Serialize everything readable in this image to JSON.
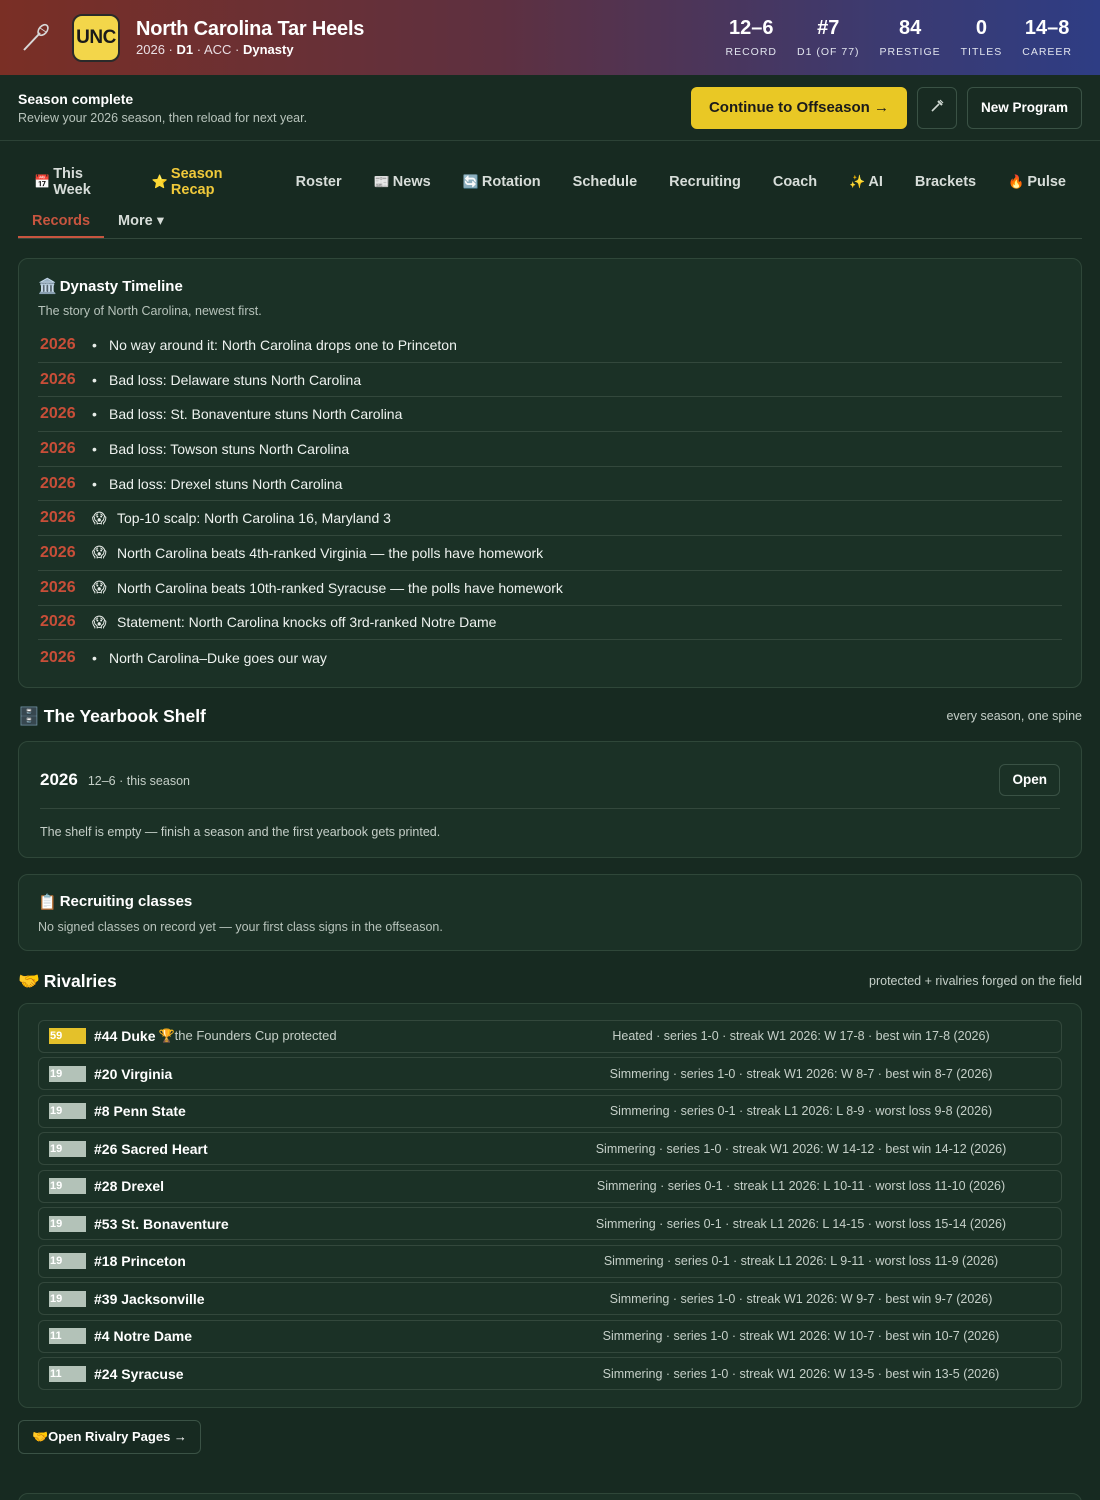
{
  "header": {
    "logo_text": "UNC",
    "program_name": "North Carolina Tar Heels",
    "sub_year": "2026",
    "sub_div": "D1",
    "sub_conf": "ACC",
    "sub_mode": "Dynasty",
    "stats": [
      {
        "value": "12–6",
        "label": "RECORD"
      },
      {
        "value": "#7",
        "label": "D1 (OF 77)"
      },
      {
        "value": "84",
        "label": "PRESTIGE"
      },
      {
        "value": "0",
        "label": "TITLES"
      },
      {
        "value": "14–8",
        "label": "CAREER"
      }
    ]
  },
  "season_bar": {
    "title": "Season complete",
    "subtitle": "Review your 2026 season, then reload for next year.",
    "continue_label": "Continue to Offseason →",
    "new_program_label": "New Program"
  },
  "tabs": [
    {
      "icon": "📅",
      "label": "This Week"
    },
    {
      "icon": "⭐",
      "label": "Season Recap"
    },
    {
      "icon": "",
      "label": "Roster"
    },
    {
      "icon": "📰",
      "label": "News"
    },
    {
      "icon": "🔄",
      "label": "Rotation"
    },
    {
      "icon": "",
      "label": "Schedule"
    },
    {
      "icon": "",
      "label": "Recruiting"
    },
    {
      "icon": "",
      "label": "Coach"
    },
    {
      "icon": "✨",
      "label": "AI"
    },
    {
      "icon": "",
      "label": "Brackets"
    },
    {
      "icon": "🔥",
      "label": "Pulse"
    }
  ],
  "subtabs": [
    {
      "label": "Records"
    },
    {
      "label": "More ▾"
    }
  ],
  "timeline": {
    "icon": "🏛️",
    "title": "Dynasty Timeline",
    "subtitle": "The story of North Carolina, newest first.",
    "entries": [
      {
        "year": "2026",
        "marker": "•",
        "text": "No way around it: North Carolina drops one to Princeton"
      },
      {
        "year": "2026",
        "marker": "•",
        "text": "Bad loss: Delaware stuns North Carolina"
      },
      {
        "year": "2026",
        "marker": "•",
        "text": "Bad loss: St. Bonaventure stuns North Carolina"
      },
      {
        "year": "2026",
        "marker": "•",
        "text": "Bad loss: Towson stuns North Carolina"
      },
      {
        "year": "2026",
        "marker": "•",
        "text": "Bad loss: Drexel stuns North Carolina"
      },
      {
        "year": "2026",
        "marker": "😱",
        "text": "Top-10 scalp: North Carolina 16, Maryland 3"
      },
      {
        "year": "2026",
        "marker": "😱",
        "text": "North Carolina beats 4th-ranked Virginia — the polls have homework"
      },
      {
        "year": "2026",
        "marker": "😱",
        "text": "North Carolina beats 10th-ranked Syracuse — the polls have homework"
      },
      {
        "year": "2026",
        "marker": "😱",
        "text": "Statement: North Carolina knocks off 3rd-ranked Notre Dame"
      },
      {
        "year": "2026",
        "marker": "•",
        "text": "North Carolina–Duke goes our way"
      }
    ]
  },
  "yearbook": {
    "icon": "🗄️",
    "title": "The Yearbook Shelf",
    "right_note": "every season, one spine",
    "year": "2026",
    "year_sub": "12–6 · this season",
    "open_label": "Open",
    "empty_text": "The shelf is empty — finish a season and the first yearbook gets printed."
  },
  "recruiting_classes": {
    "icon": "📋",
    "title": "Recruiting classes",
    "text": "No signed classes on record yet — your first class signs in the offseason."
  },
  "rivalries": {
    "icon": "🤝",
    "title": "Rivalries",
    "right_note": "protected + rivalries forged on the field",
    "open_pages_label": "🤝Open Rivalry Pages →",
    "items": [
      {
        "heat": "59",
        "heat_fraction": 0.59,
        "name": "#44 Duke",
        "note": "🏆the Founders Cup protected",
        "detail": "Heated · series 1-0 · streak W1  2026: W 17-8 · best win 17-8 (2026)"
      },
      {
        "heat": "19",
        "heat_fraction": 0,
        "name": "#20 Virginia",
        "note": "",
        "detail": "Simmering · series 1-0 · streak W1  2026: W 8-7 · best win 8-7 (2026)"
      },
      {
        "heat": "19",
        "heat_fraction": 0,
        "name": "#8 Penn State",
        "note": "",
        "detail": "Simmering · series 0-1 · streak L1  2026: L 8-9 · worst loss 9-8 (2026)"
      },
      {
        "heat": "19",
        "heat_fraction": 0,
        "name": "#26 Sacred Heart",
        "note": "",
        "detail": "Simmering · series 1-0 · streak W1  2026: W 14-12 · best win 14-12 (2026)"
      },
      {
        "heat": "19",
        "heat_fraction": 0,
        "name": "#28 Drexel",
        "note": "",
        "detail": "Simmering · series 0-1 · streak L1  2026: L 10-11 · worst loss 11-10 (2026)"
      },
      {
        "heat": "19",
        "heat_fraction": 0,
        "name": "#53 St. Bonaventure",
        "note": "",
        "detail": "Simmering · series 0-1 · streak L1  2026: L 14-15 · worst loss 15-14 (2026)"
      },
      {
        "heat": "19",
        "heat_fraction": 0,
        "name": "#18 Princeton",
        "note": "",
        "detail": "Simmering · series 0-1 · streak L1  2026: L 9-11 · worst loss 11-9 (2026)"
      },
      {
        "heat": "19",
        "heat_fraction": 0,
        "name": "#39 Jacksonville",
        "note": "",
        "detail": "Simmering · series 1-0 · streak W1  2026: W 9-7 · best win 9-7 (2026)"
      },
      {
        "heat": "11",
        "heat_fraction": 0,
        "name": "#4 Notre Dame",
        "note": "",
        "detail": "Simmering · series 1-0 · streak W1  2026: W 10-7 · best win 10-7 (2026)"
      },
      {
        "heat": "11",
        "heat_fraction": 0,
        "name": "#24 Syracuse",
        "note": "",
        "detail": "Simmering · series 1-0 · streak W1  2026: W 13-5 · best win 13-5 (2026)"
      }
    ]
  },
  "colors": {
    "accent_gold": "#e9c825",
    "accent_red": "#c84e38",
    "background": "#172a21"
  }
}
